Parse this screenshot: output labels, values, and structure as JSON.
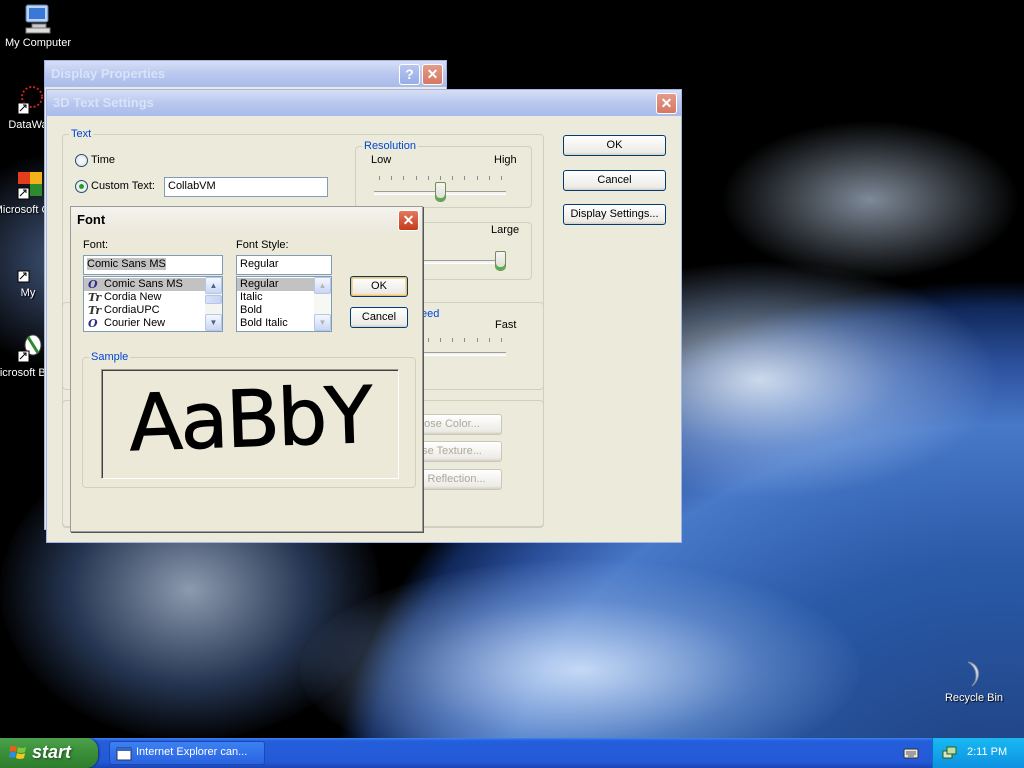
{
  "desktop": {
    "icons": [
      {
        "label": "My Computer"
      },
      {
        "label": "DataWa"
      },
      {
        "label": "Microsoft C++"
      },
      {
        "label": "My"
      },
      {
        "label": "Microsoft Basic"
      },
      {
        "label": "Recycle Bin"
      }
    ]
  },
  "display_properties": {
    "title": "Display Properties",
    "help_glyph": "?",
    "close_glyph": "✕"
  },
  "text_settings": {
    "title": "3D Text Settings",
    "close_glyph": "✕",
    "text_group": "Text",
    "time_label": "Time",
    "custom_text_label": "Custom Text:",
    "custom_text_value": "CollabVM",
    "resolution_group": "Resolution",
    "res_low": "Low",
    "res_high": "High",
    "resolution_value": 0.5,
    "size_large": "Large",
    "size_value": 1.0,
    "speed_partial": "eed",
    "speed_fast": "Fast",
    "speed_value": 0.05,
    "choose_color": "ose Color...",
    "choose_texture": "se Texture...",
    "choose_reflection": "e Reflection...",
    "ok": "OK",
    "cancel": "Cancel",
    "display_settings": "Display Settings..."
  },
  "font_dialog": {
    "title": "Font",
    "close_glyph": "✕",
    "font_label": "Font:",
    "font_value": "Comic Sans MS",
    "fonts": [
      {
        "icon": "O",
        "name": "Comic Sans MS"
      },
      {
        "icon": "Tr",
        "name": "Cordia New"
      },
      {
        "icon": "Tr",
        "name": "CordiaUPC"
      },
      {
        "icon": "O",
        "name": "Courier New"
      }
    ],
    "style_label": "Font Style:",
    "style_value": "Regular",
    "styles": [
      "Regular",
      "Italic",
      "Bold",
      "Bold Italic"
    ],
    "ok": "OK",
    "cancel": "Cancel",
    "sample_group": "Sample",
    "sample_text": "AaBbY"
  },
  "taskbar": {
    "start_label": "start",
    "task_label": "Internet Explorer can...",
    "clock": "2:11 PM"
  }
}
